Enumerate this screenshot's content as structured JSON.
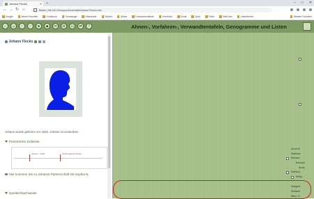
{
  "browser": {
    "tab_title": "Johann Flecks",
    "new_tab": "+",
    "window_controls": [
      "–",
      "□",
      "✕"
    ],
    "nav": [
      "←",
      "→",
      "↻",
      "⌂"
    ],
    "url": "Bösen | file:///C:/Genopro/Ahnentafel/Johann Flecks.htm",
    "bookmarks": [
      "Google",
      "Meine Favoriten",
      "Goodbook",
      "Genealogie",
      "Übersetzer",
      "Bücher",
      "Album",
      "Lesezeichenleiste",
      "Facebook",
      "Email",
      "Sport",
      "Filme",
      "WebCam",
      "Lesezeichen"
    ],
    "bookmarks_right": "Weitere Favoriten"
  },
  "app": {
    "title": "Ahnen-, Vorfahren-, Verwandtentafeln, Genogramme und Listen",
    "tool_glyphs": [
      "⌂",
      "☺",
      "♀",
      "♂",
      "♣",
      "◆",
      "✉",
      "⚙",
      "☷",
      "⇄",
      "?"
    ]
  },
  "person": {
    "name": "Johann Flecks",
    "born_text": "Johann wurde geboren vor 1626.   Johann ist verstorben."
  },
  "sections": {
    "timeline_heading": "Persönliche Zeitleiste",
    "partner_text": "Hier kommen Sie zu Johanns Partnerschaft mit Sophia N.",
    "sources_heading": "Quellen/Nachweise"
  },
  "timeline": {
    "event1": "Geburt < 1626",
    "event2": "Tochtergeburt Flecks"
  },
  "right_labels": [
    "Anna M.",
    "Matthias",
    "Michael",
    "Barbara",
    "Anna",
    "Katharin.",
    "Willig",
    "Margare.",
    "Stefanie",
    "Nikol. G."
  ]
}
